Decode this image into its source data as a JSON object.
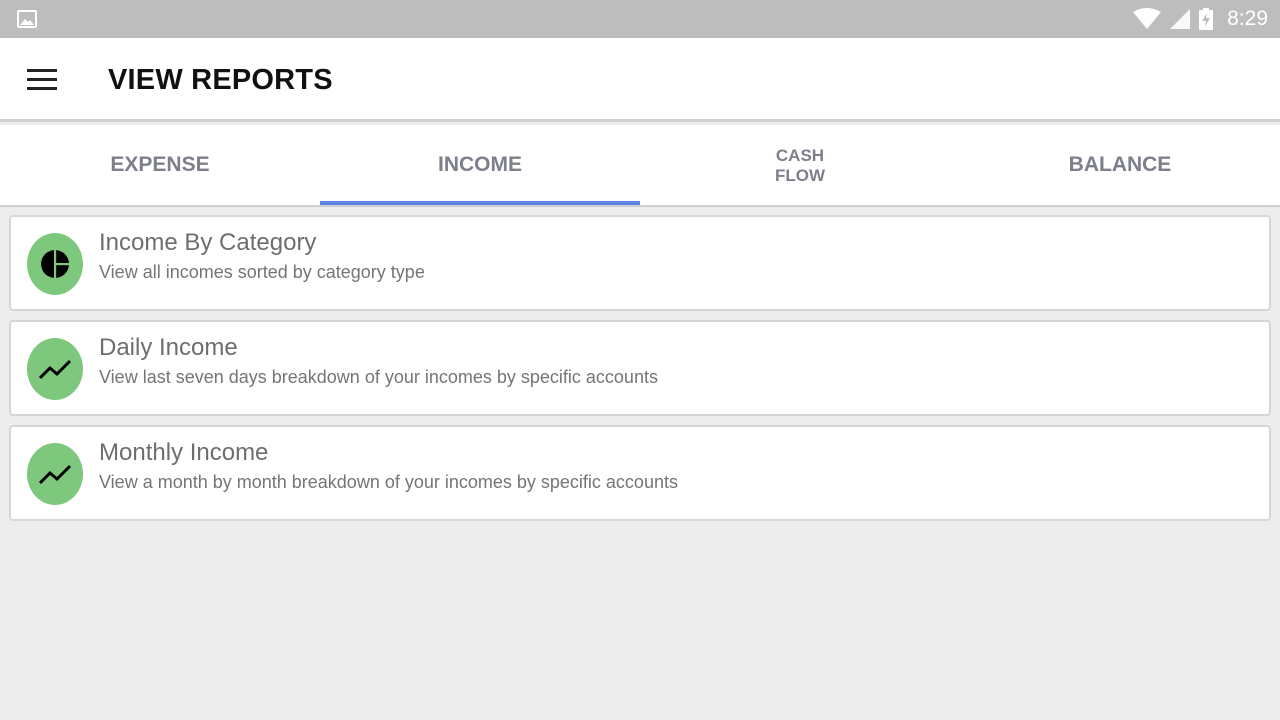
{
  "status_bar": {
    "time": "8:29",
    "icons": [
      "gallery-icon",
      "wifi-icon",
      "cell-signal-icon",
      "battery-charging-icon"
    ]
  },
  "app_bar": {
    "title": "VIEW REPORTS",
    "menu_icon": "hamburger-menu-icon"
  },
  "tabs": [
    {
      "label": "EXPENSE",
      "active": false
    },
    {
      "label": "INCOME",
      "active": true
    },
    {
      "label": "CASH\nFLOW",
      "active": false
    },
    {
      "label": "BALANCE",
      "active": false
    }
  ],
  "reports": [
    {
      "title": "Income By Category",
      "description": "View all incomes sorted by category type",
      "icon": "pie-chart-icon"
    },
    {
      "title": "Daily Income",
      "description": "View last seven days breakdown of your incomes by specific accounts",
      "icon": "trending-line-icon"
    },
    {
      "title": "Monthly Income",
      "description": "View a month by month breakdown of your incomes by specific accounts",
      "icon": "trending-line-icon"
    }
  ],
  "colors": {
    "status_bar": "#bdbdbd",
    "tab_indicator": "#5b86e5",
    "icon_circle": "#7ec87e",
    "background": "#ededed"
  }
}
